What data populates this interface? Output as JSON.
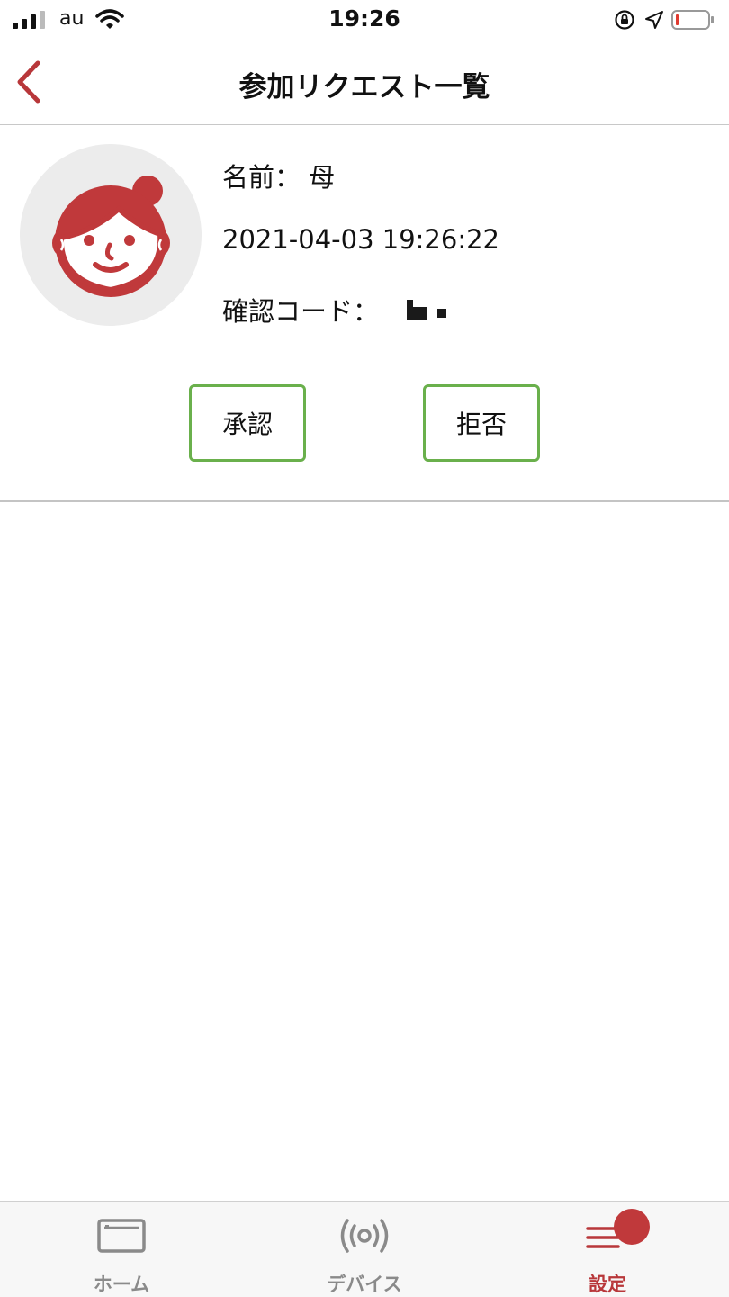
{
  "status_bar": {
    "carrier": "au",
    "time": "19:26"
  },
  "nav": {
    "title": "参加リクエスト一覧"
  },
  "request": {
    "name_label": "名前：",
    "name_value": "母",
    "datetime": "2021-04-03 19:26:22",
    "code_label": "確認コード："
  },
  "actions": {
    "approve_label": "承認",
    "reject_label": "拒否"
  },
  "tabs": [
    {
      "label": "ホーム",
      "icon": "home-icon",
      "active": false
    },
    {
      "label": "デバイス",
      "icon": "device-signal-icon",
      "active": false
    },
    {
      "label": "設定",
      "icon": "settings-menu-icon",
      "active": true
    }
  ],
  "colors": {
    "accent_red": "#b8373a",
    "button_border_green": "#6ab04c",
    "tab_inactive": "#8a8a8a",
    "avatar_bg": "#ececec"
  }
}
